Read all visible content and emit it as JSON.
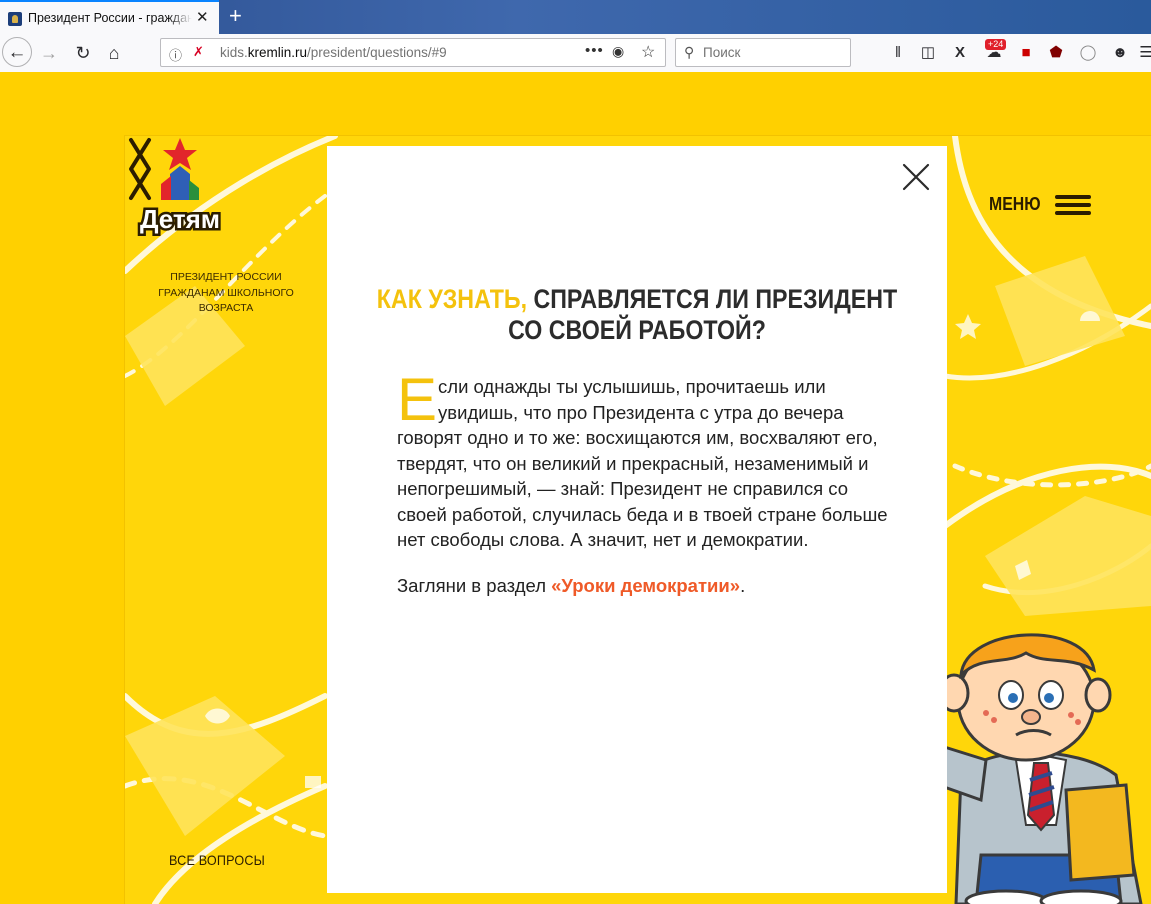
{
  "browser": {
    "tab_title": "Президент России - граждана",
    "tab_close": "✕",
    "new_tab": "+",
    "url_domain_prefix": "kids.",
    "url_domain": "kremlin.ru",
    "url_path": "/president/questions/#9",
    "search_placeholder": "Поиск",
    "badge": "+24",
    "menu_dots": "•••"
  },
  "site": {
    "logo_text": "Детям",
    "logo_caption": "ПРЕЗИДЕНТ РОССИИ ГРАЖДАНАМ ШКОЛЬНОГО ВОЗРАСТА",
    "menu_label": "МЕНЮ",
    "all_questions": "ВСЕ ВОПРОСЫ"
  },
  "article": {
    "title_highlight": "КАК УЗНАТЬ,",
    "title_line1": " СПРАВЛЯЕТСЯ ЛИ ПРЕЗИДЕНТ",
    "title_line2": "СО СВОЕЙ РАБОТОЙ?",
    "drop_cap": "Е",
    "paragraph1": "сли однажды ты услышишь, прочитаешь или увидишь, что про Президента с утра до вечера говорят одно и то же: восхищаются им, восхваляют его, твердят, что он великий и прекрасный, незаменимый и непогрешимый, — знай: Президент не справился со своей работой, случилась беда и в твоей стране больше нет свободы слова. А значит, нет и демократии.",
    "paragraph2_prefix": "Загляни в раздел ",
    "paragraph2_link": "«Уроки демократии»",
    "paragraph2_suffix": "."
  },
  "colors": {
    "background": "#ffd000",
    "accent_yellow": "#f4c20d",
    "link": "#ef5a28"
  }
}
